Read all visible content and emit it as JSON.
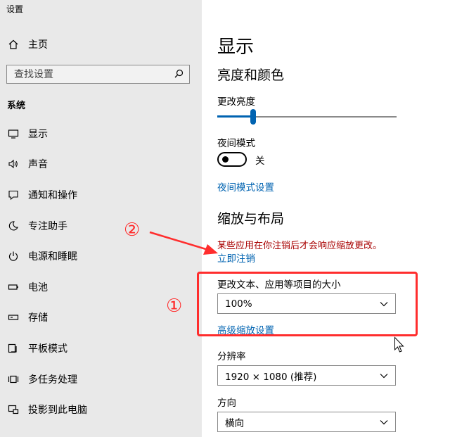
{
  "window": {
    "title": "设置"
  },
  "sidebar": {
    "home_label": "主页",
    "search_placeholder": "查找设置",
    "section_title": "系统",
    "items": [
      {
        "label": "显示",
        "icon": "monitor-icon"
      },
      {
        "label": "声音",
        "icon": "speaker-icon"
      },
      {
        "label": "通知和操作",
        "icon": "notification-icon"
      },
      {
        "label": "专注助手",
        "icon": "moon-icon"
      },
      {
        "label": "电源和睡眠",
        "icon": "power-icon"
      },
      {
        "label": "电池",
        "icon": "battery-icon"
      },
      {
        "label": "存储",
        "icon": "storage-icon"
      },
      {
        "label": "平板模式",
        "icon": "tablet-icon"
      },
      {
        "label": "多任务处理",
        "icon": "multitask-icon"
      },
      {
        "label": "投影到此电脑",
        "icon": "project-icon"
      }
    ]
  },
  "main": {
    "page_title": "显示",
    "brightness_section": {
      "heading": "亮度和颜色",
      "brightness_label": "更改亮度",
      "brightness_level": 0.2,
      "night_mode_label": "夜间模式",
      "night_mode_state": "关",
      "night_mode_link": "夜间模式设置"
    },
    "scale_section": {
      "heading": "缩放与布局",
      "warning": "某些应用在你注销后才会响应缩放更改。",
      "signout_link": "立即注销",
      "size_label": "更改文本、应用等项目的大小",
      "size_value": "100%",
      "advanced_link": "高级缩放设置",
      "resolution_label": "分辨率",
      "resolution_value": "1920 × 1080 (推荐)",
      "orientation_label": "方向",
      "orientation_value": "横向"
    }
  },
  "annotations": {
    "marker_1": "①",
    "marker_2": "②"
  },
  "colors": {
    "accent": "#0063b1",
    "warning": "#a80000",
    "annotation": "#ff2d2d",
    "sidebar_bg": "#e9e9e9"
  }
}
